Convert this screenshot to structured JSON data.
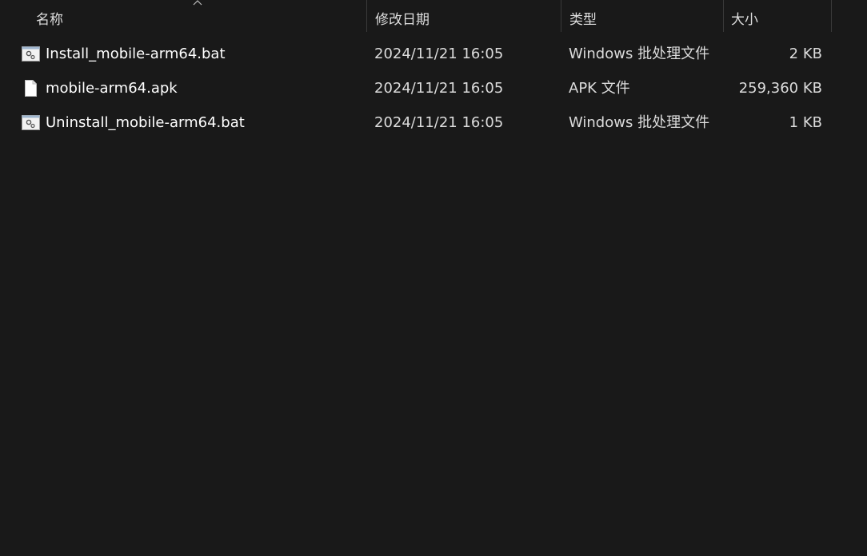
{
  "columns": {
    "name": "名称",
    "date": "修改日期",
    "type": "类型",
    "size": "大小"
  },
  "sort": {
    "column": "name",
    "direction": "ascending"
  },
  "files": [
    {
      "name": "Install_mobile-arm64.bat",
      "date": "2024/11/21 16:05",
      "type": "Windows 批处理文件",
      "size": "2 KB",
      "icon": "batch-file-icon"
    },
    {
      "name": "mobile-arm64.apk",
      "date": "2024/11/21 16:05",
      "type": "APK 文件",
      "size": "259,360 KB",
      "icon": "file-icon"
    },
    {
      "name": "Uninstall_mobile-arm64.bat",
      "date": "2024/11/21 16:05",
      "type": "Windows 批处理文件",
      "size": "1 KB",
      "icon": "batch-file-icon"
    }
  ]
}
